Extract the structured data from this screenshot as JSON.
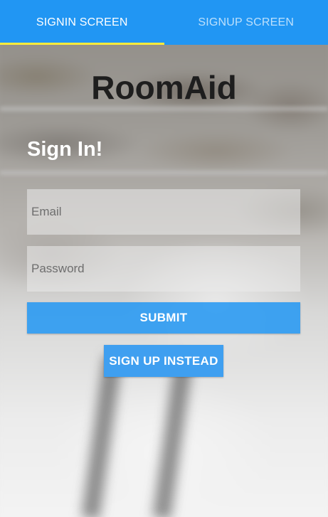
{
  "tabs": [
    {
      "label": "SIGNIN SCREEN",
      "active": true
    },
    {
      "label": "SIGNUP SCREEN",
      "active": false
    }
  ],
  "app": {
    "title": "RoomAid"
  },
  "signin": {
    "heading": "Sign In!",
    "email_placeholder": "Email",
    "password_placeholder": "Password",
    "submit_label": "SUBMIT",
    "signup_label": "SIGN UP INSTEAD"
  },
  "colors": {
    "primary": "#2196f3",
    "tab_indicator": "#ffeb3b",
    "title": "#1e1e1e"
  }
}
